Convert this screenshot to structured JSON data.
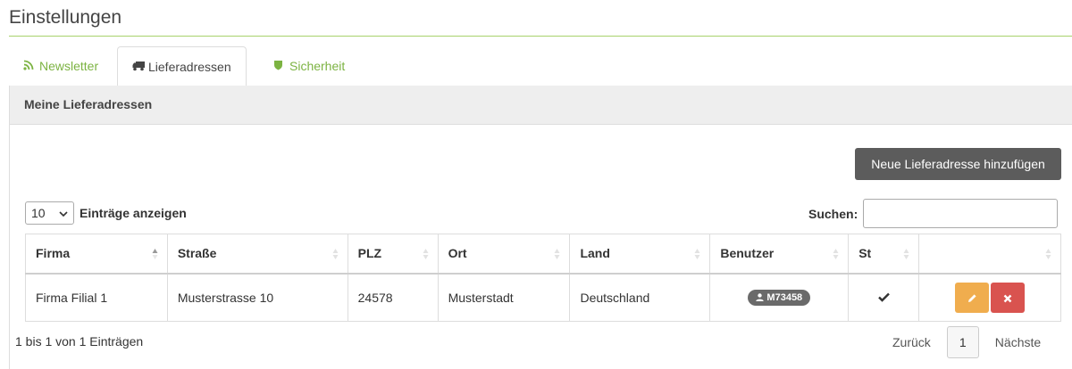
{
  "page": {
    "title": "Einstellungen"
  },
  "tabs": [
    {
      "label": "Newsletter",
      "icon": "rss-icon",
      "active": false
    },
    {
      "label": "Lieferadressen",
      "icon": "truck-icon",
      "active": true
    },
    {
      "label": "Sicherheit",
      "icon": "shield-icon",
      "active": false
    }
  ],
  "panel": {
    "title": "Meine Lieferadressen",
    "add_button": "Neue Lieferadresse hinzufügen"
  },
  "table_controls": {
    "length_value": "10",
    "length_label": "Einträge anzeigen",
    "search_label": "Suchen:",
    "search_value": ""
  },
  "table": {
    "columns": [
      "Firma",
      "Straße",
      "PLZ",
      "Ort",
      "Land",
      "Benutzer",
      "St",
      ""
    ],
    "rows": [
      {
        "firma": "Firma Filial 1",
        "strasse": "Musterstrasse 10",
        "plz": "24578",
        "ort": "Musterstadt",
        "land": "Deutschland",
        "benutzer": "M73458",
        "status_icon": "check-icon"
      }
    ]
  },
  "footer": {
    "info": "1 bis 1 von 1 Einträgen",
    "prev": "Zurück",
    "current_page": "1",
    "next": "Nächste"
  },
  "colors": {
    "accent_green": "#7cb342",
    "edit": "#f0ad4e",
    "delete": "#d9534f",
    "button_dark": "#5c5c5c"
  }
}
